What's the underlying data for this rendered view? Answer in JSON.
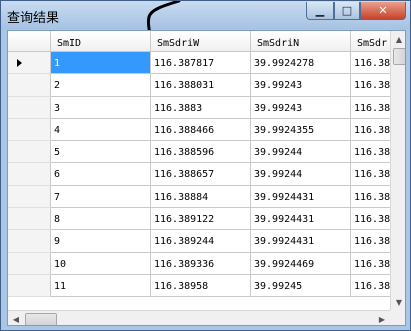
{
  "window": {
    "title": "查询结果"
  },
  "grid": {
    "columns": [
      "SmID",
      "SmSdriW",
      "SmSdriN",
      "SmSdr"
    ],
    "rows": [
      [
        "1",
        "116.387817",
        "39.9924278",
        "116.38"
      ],
      [
        "2",
        "116.388031",
        "39.99243",
        "116.38"
      ],
      [
        "3",
        "116.3883",
        "39.99243",
        "116.38"
      ],
      [
        "4",
        "116.388466",
        "39.9924355",
        "116.38"
      ],
      [
        "5",
        "116.388596",
        "39.99244",
        "116.38"
      ],
      [
        "6",
        "116.388657",
        "39.99244",
        "116.38"
      ],
      [
        "7",
        "116.38884",
        "39.9924431",
        "116.38"
      ],
      [
        "8",
        "116.389122",
        "39.9924431",
        "116.38"
      ],
      [
        "9",
        "116.389244",
        "39.9924431",
        "116.38"
      ],
      [
        "10",
        "116.389336",
        "39.9924469",
        "116.38"
      ],
      [
        "11",
        "116.38958",
        "39.99245",
        "116.38"
      ]
    ],
    "selected_row": 1
  },
  "colors": {
    "selection": "#3399ff",
    "title_bar": "#a9c6e6",
    "close_button": "#c7432a"
  }
}
